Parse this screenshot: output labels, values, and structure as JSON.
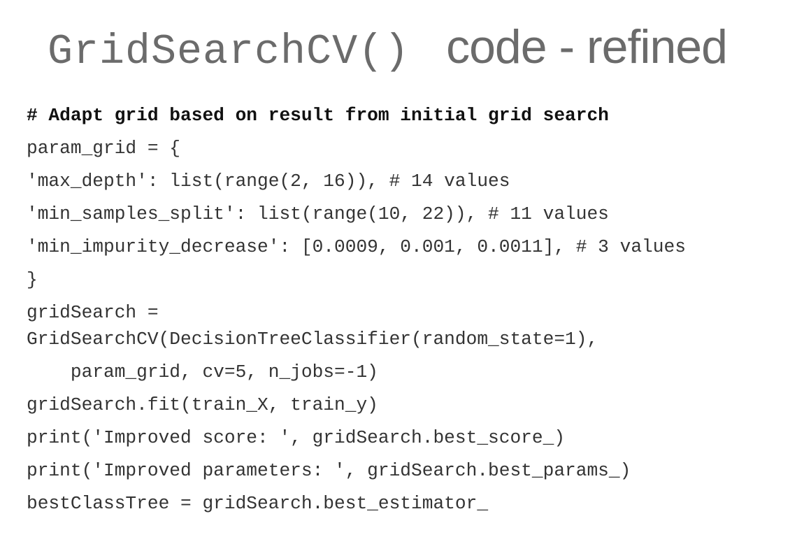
{
  "title": {
    "code_part": "GridSearchCV()",
    "text_part": "code - refined"
  },
  "code_lines": [
    "# Adapt grid based on result from initial grid search",
    "param_grid = {",
    "'max_depth': list(range(2, 16)), # 14 values",
    "'min_samples_split': list(range(10, 22)), # 11 values",
    "'min_impurity_decrease': [0.0009, 0.001, 0.0011], # 3 values",
    "}",
    "gridSearch =",
    "GridSearchCV(DecisionTreeClassifier(random_state=1),",
    "    param_grid, cv=5, n_jobs=-1)",
    "gridSearch.fit(train_X, train_y)",
    "print('Improved score: ', gridSearch.best_score_)",
    "print('Improved parameters: ', gridSearch.best_params_)",
    "bestClassTree = gridSearch.best_estimator_"
  ]
}
